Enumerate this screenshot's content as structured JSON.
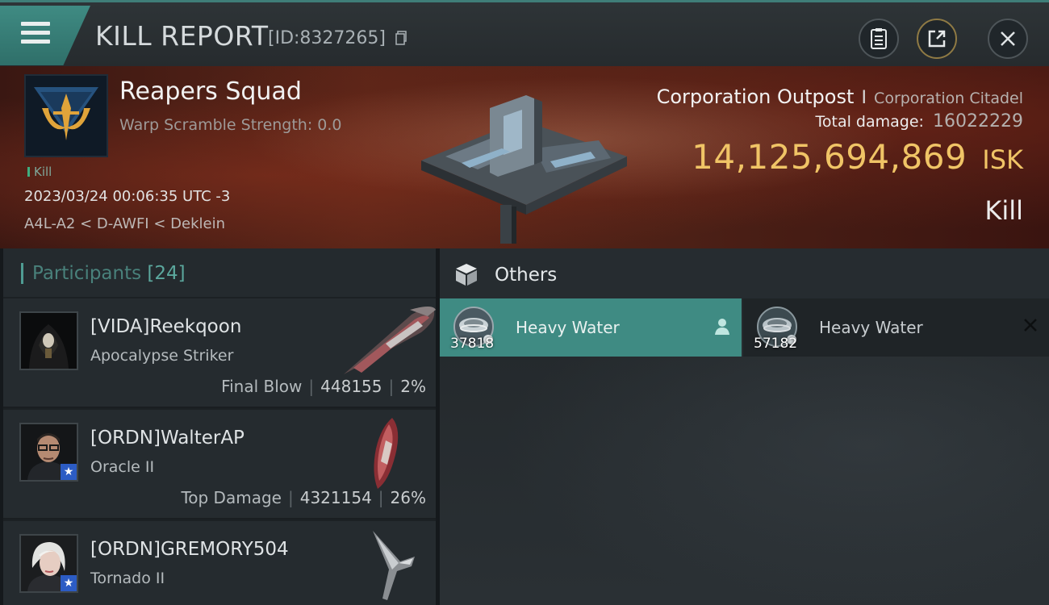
{
  "header": {
    "title": "KILL REPORT",
    "report_id": "[ID:8327265]",
    "buttons": [
      "clipboard-icon",
      "share-icon",
      "close-icon"
    ]
  },
  "banner": {
    "corp_name": "Reapers Squad",
    "warp_text": "Warp Scramble Strength: 0.0",
    "kill_tag": "Kill",
    "datetime": "2023/03/24 00:06:35 UTC -3",
    "location": "A4L-A2 < D-AWFI < Deklein",
    "victim_type": "Corporation Outpost",
    "victim_separator": "I",
    "victim_class": "Corporation Citadel",
    "total_damage_label": "Total damage:",
    "total_damage_value": "16022229",
    "isk_value": "14,125,694,869",
    "isk_unit": "ISK",
    "result": "Kill",
    "accent_color": "#f0c466"
  },
  "participants": {
    "title": "Participants",
    "count": "[24]",
    "rows": [
      {
        "name": "[VIDA]Reekqoon",
        "ship": "Apocalypse Striker",
        "role": "Final Blow",
        "damage": "448155",
        "percent": "2%"
      },
      {
        "name": "[ORDN]WalterAP",
        "ship": "Oracle II",
        "role": "Top Damage",
        "damage": "4321154",
        "percent": "26%"
      },
      {
        "name": "[ORDN]GREMORY504",
        "ship": "Tornado II",
        "role": "",
        "damage": "",
        "percent": ""
      }
    ],
    "separator": "|"
  },
  "others": {
    "title": "Others",
    "items": [
      {
        "name": "Heavy Water",
        "qty": "37818",
        "icon": "heavy-water-icon",
        "selected": true
      },
      {
        "name": "Heavy Water",
        "qty": "57182",
        "icon": "heavy-water-icon",
        "selected": false
      }
    ]
  }
}
